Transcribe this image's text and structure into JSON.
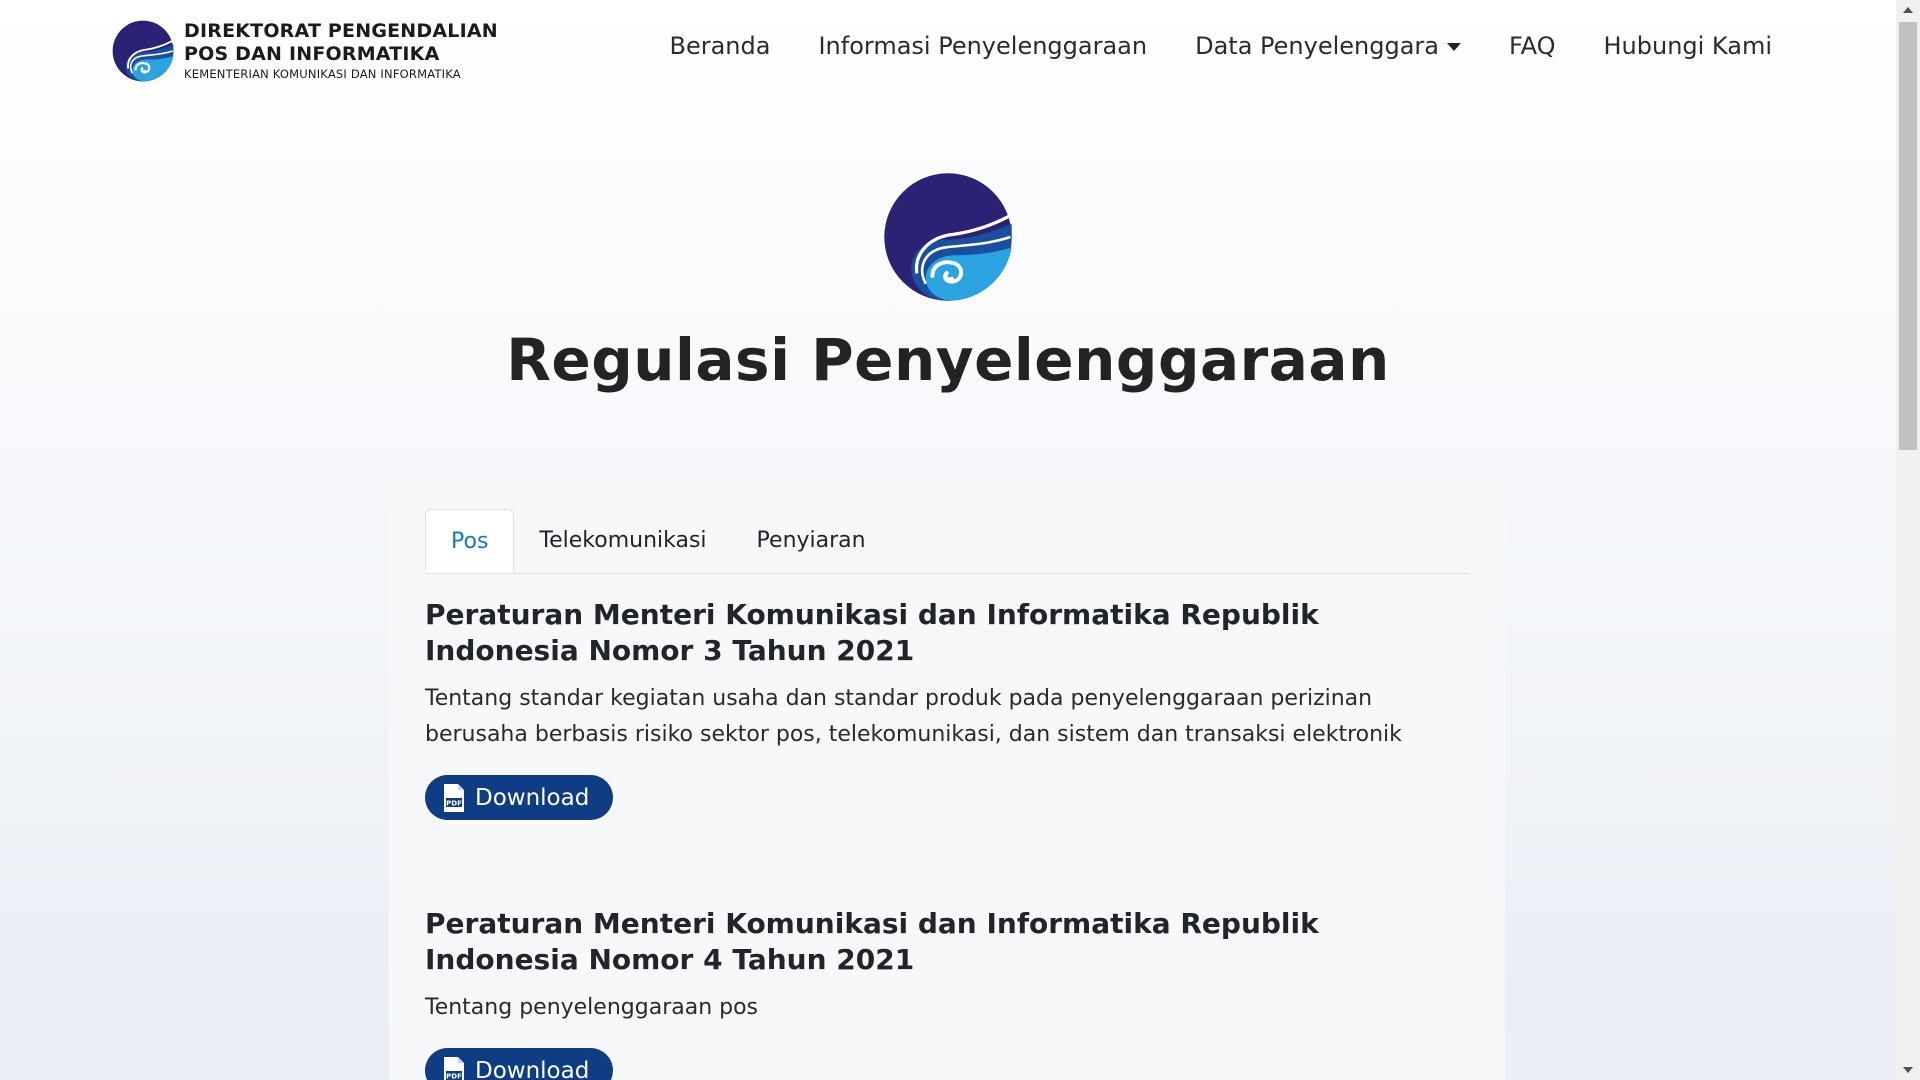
{
  "brand": {
    "line1": "DIREKTORAT PENGENDALIAN",
    "line2": "POS DAN INFORMATIKA",
    "line3": "KEMENTERIAN KOMUNIKASI DAN INFORMATIKA",
    "logo_icon": "kominfo-logo-icon"
  },
  "nav": {
    "items": [
      {
        "label": "Beranda"
      },
      {
        "label": "Informasi Penyelenggaraan"
      },
      {
        "label": "Data Penyelenggara",
        "dropdown": true
      },
      {
        "label": "FAQ"
      },
      {
        "label": "Hubungi Kami"
      }
    ]
  },
  "hero": {
    "title": "Regulasi Penyelenggaraan",
    "logo_icon": "kominfo-logo-icon"
  },
  "tabs": [
    {
      "label": "Pos",
      "active": true
    },
    {
      "label": "Telekomunikasi",
      "active": false
    },
    {
      "label": "Penyiaran",
      "active": false
    }
  ],
  "regulations": [
    {
      "title": "Peraturan Menteri Komunikasi dan Informatika Republik Indonesia Nomor 3 Tahun 2021",
      "description": "Tentang standar kegiatan usaha dan standar produk pada penyelenggaraan perizinan berusaha berbasis risiko sektor pos, telekomunikasi, dan sistem dan transaksi elektronik",
      "button_label": "Download",
      "button_icon": "pdf-file-icon"
    },
    {
      "title": "Peraturan Menteri Komunikasi dan Informatika Republik Indonesia Nomor 4 Tahun 2021",
      "description": "Tentang penyelenggaraan pos",
      "button_label": "Download",
      "button_icon": "pdf-file-icon"
    }
  ],
  "colors": {
    "accent": "#1677c8",
    "button": "#0e3d84",
    "logo_dark": "#2b2275",
    "logo_mid": "#1a4fa0",
    "logo_light": "#2ba3e0"
  }
}
